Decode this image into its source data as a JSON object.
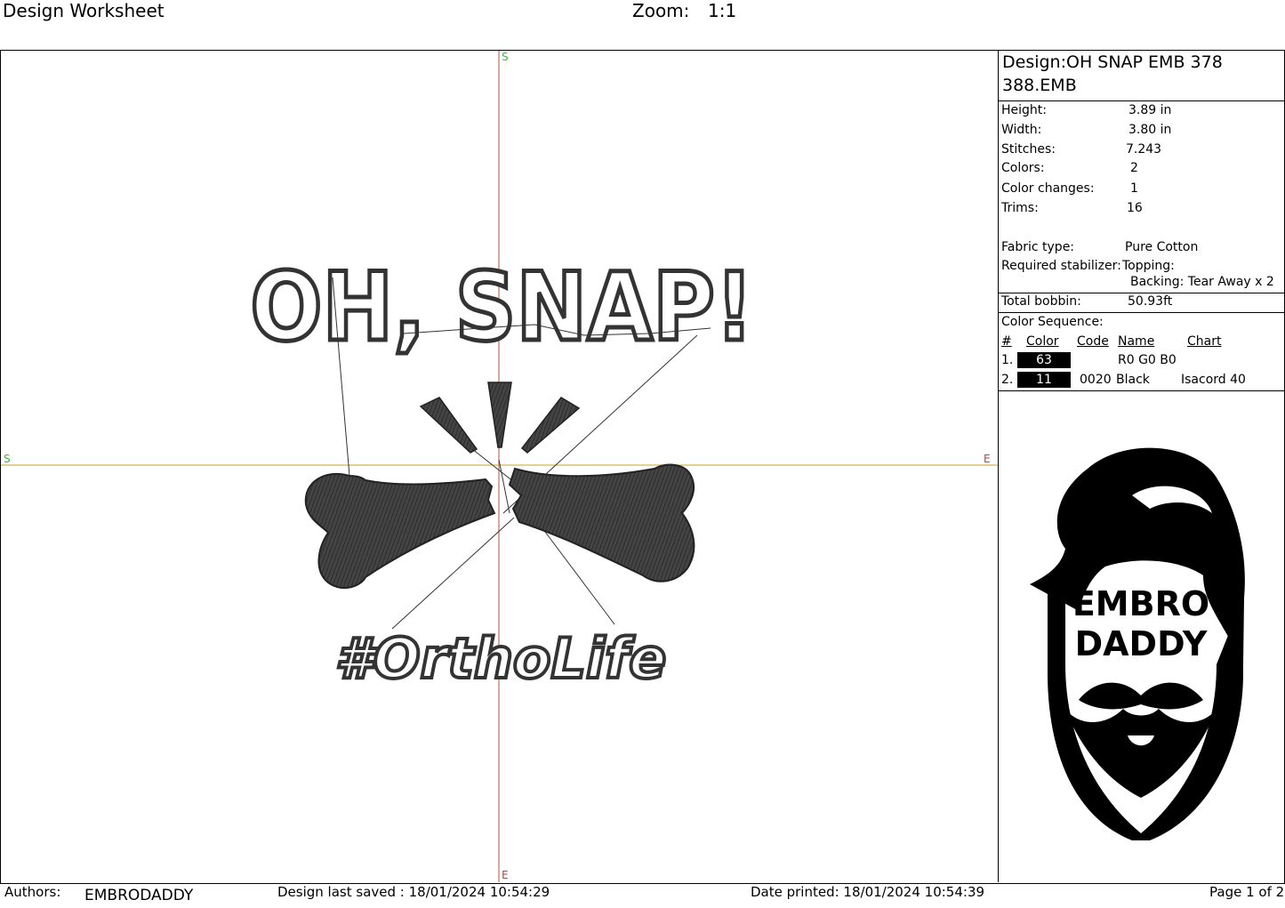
{
  "header": {
    "title": "Design Worksheet",
    "zoom_label": "Zoom:",
    "zoom_value": "1:1"
  },
  "canvas": {
    "marker_start": "S",
    "marker_end": "E",
    "design_text_top": "OH, SNAP!",
    "design_text_bottom": "#OrthoLife"
  },
  "info": {
    "design_label": "Design:OH SNAP EMB 378",
    "design_label_line2": "388.EMB",
    "height_label": "Height:",
    "height_value": "3.89 in",
    "width_label": "Width:",
    "width_value": "3.80 in",
    "stitches_label": "Stitches:",
    "stitches_value": "7.243",
    "colors_label": "Colors:",
    "colors_value": "2",
    "color_changes_label": "Color changes:",
    "color_changes_value": "1",
    "trims_label": "Trims:",
    "trims_value": "16",
    "fabric_label": "Fabric type:",
    "fabric_value": "Pure Cotton",
    "stabilizer_label": "Required stabilizer:",
    "topping_value": "Topping:",
    "backing_value": "Backing: Tear Away x 2",
    "bobbin_label": "Total bobbin:",
    "bobbin_value": "50.93ft",
    "color_sequence_label": "Color Sequence:",
    "columns": {
      "num": "#",
      "color": "Color",
      "code": "Code",
      "name": "Name",
      "chart": "Chart"
    },
    "colors": [
      {
        "num": "1.",
        "color": "63",
        "code": "",
        "name": "R0 G0 B0",
        "chart": ""
      },
      {
        "num": "2.",
        "color": "11",
        "code": "0020",
        "name": "Black",
        "chart": "Isacord 40"
      }
    ],
    "logo_text_1": "EMBRO",
    "logo_text_2": "DADDY"
  },
  "footer": {
    "authors_label": "Authors:",
    "authors_value": "EMBRODADDY",
    "saved": "Design last saved : 18/01/2024 10:54:29",
    "printed": "Date printed: 18/01/2024 10:54:39",
    "page": "Page 1 of 2"
  }
}
